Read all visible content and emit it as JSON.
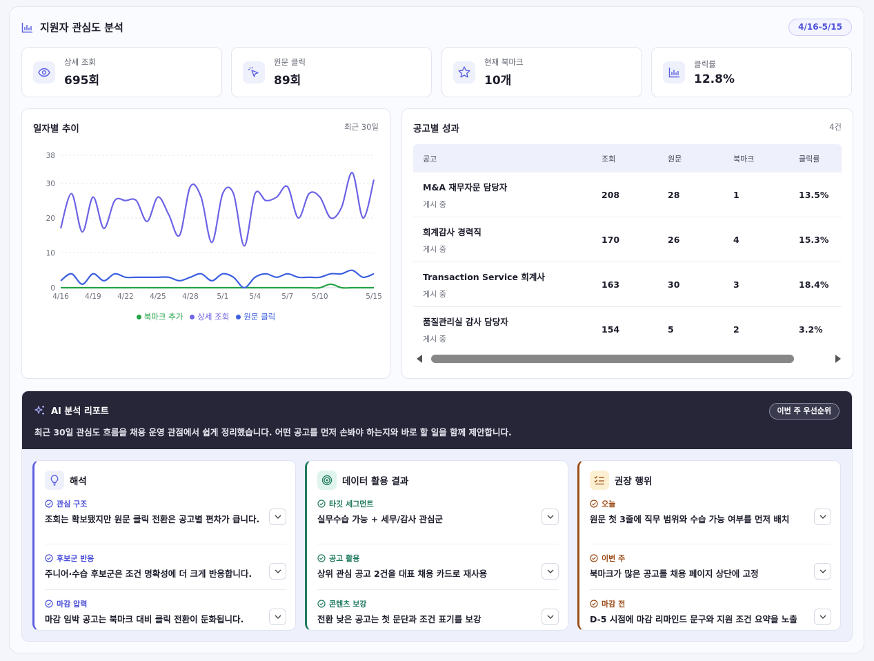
{
  "header": {
    "title": "지원자 관심도 분석",
    "date_range": "4/16-5/15"
  },
  "kpis": [
    {
      "label": "상세 조회",
      "value": "695회",
      "icon": "eye-icon"
    },
    {
      "label": "원문 클릭",
      "value": "89회",
      "icon": "cursor-click-icon"
    },
    {
      "label": "현재 북마크",
      "value": "10개",
      "icon": "star-icon"
    },
    {
      "label": "클릭률",
      "value": "12.8%",
      "icon": "bar-chart-icon"
    }
  ],
  "trend": {
    "title": "일자별 추이",
    "period": "최근 30일",
    "legend": [
      "북마크 추가",
      "상세 조회",
      "원문 클릭"
    ]
  },
  "chart_data": {
    "type": "line",
    "x_ticks": [
      "4/16",
      "4/19",
      "4/22",
      "4/25",
      "4/28",
      "5/1",
      "5/4",
      "5/7",
      "5/10",
      "5/15"
    ],
    "x": [
      "4/16",
      "4/17",
      "4/18",
      "4/19",
      "4/20",
      "4/21",
      "4/22",
      "4/23",
      "4/24",
      "4/25",
      "4/26",
      "4/27",
      "4/28",
      "4/29",
      "4/30",
      "5/1",
      "5/2",
      "5/3",
      "5/4",
      "5/5",
      "5/6",
      "5/7",
      "5/8",
      "5/9",
      "5/10",
      "5/11",
      "5/12",
      "5/13",
      "5/14",
      "5/15"
    ],
    "ylim": [
      0,
      38
    ],
    "y_ticks": [
      0,
      10,
      20,
      30,
      38
    ],
    "grid": true,
    "legend_position": "bottom",
    "series": [
      {
        "name": "상세 조회",
        "color": "#6c63e6",
        "values": [
          17,
          27,
          16,
          26,
          17,
          25,
          25,
          25,
          19,
          26,
          21,
          15,
          29,
          26,
          13,
          27,
          27,
          12,
          27,
          25,
          26,
          29,
          20,
          27,
          26,
          20,
          23,
          33,
          20,
          31
        ]
      },
      {
        "name": "원문 클릭",
        "color": "#3b5fe0",
        "values": [
          2,
          4,
          1,
          4,
          2,
          4,
          3,
          3,
          3,
          3,
          3,
          2,
          3,
          4,
          2,
          4,
          3,
          0,
          3,
          4,
          3,
          4,
          3,
          3,
          3,
          4,
          4,
          5,
          3,
          4
        ]
      },
      {
        "name": "북마크 추가",
        "color": "#22a244",
        "values": [
          0,
          0,
          0,
          0,
          0,
          0,
          0,
          0,
          0,
          0,
          0,
          0,
          0,
          0,
          0,
          0,
          0,
          0,
          0,
          0,
          0,
          0,
          0,
          0,
          0,
          1,
          0,
          0,
          0,
          0
        ]
      }
    ]
  },
  "postings": {
    "title": "공고별 성과",
    "count": "4건",
    "columns": [
      "공고",
      "조회",
      "원문",
      "북마크",
      "클릭률"
    ],
    "rows": [
      {
        "name": "M&A 재무자문 담당자",
        "status": "게시 중",
        "views": "208",
        "clicks": "28",
        "bookmarks": "1",
        "ctr": "13.5%"
      },
      {
        "name": "회계감사 경력직",
        "status": "게시 중",
        "views": "170",
        "clicks": "26",
        "bookmarks": "4",
        "ctr": "15.3%"
      },
      {
        "name": "Transaction Service 회계사",
        "status": "게시 중",
        "views": "163",
        "clicks": "30",
        "bookmarks": "3",
        "ctr": "18.4%"
      },
      {
        "name": "품질관리실 감사 담당자",
        "status": "게시 중",
        "views": "154",
        "clicks": "5",
        "bookmarks": "2",
        "ctr": "3.2%"
      }
    ]
  },
  "ai": {
    "title": "AI 분석 리포트",
    "badge": "이번 주 우선순위",
    "description": "최근 30일 관심도 흐름을 채용 운영 관점에서 쉽게 정리했습니다. 어떤 공고를 먼저 손봐야 하는지와 바로 할 일을 함께 제안합니다.",
    "cards": [
      {
        "title": "해석",
        "icon": "lightbulb-icon",
        "accent": "#5b5fe0",
        "icon_bg": "#eef0fb",
        "tag_color": "#4b4fd8",
        "items": [
          {
            "tag": "관심 구조",
            "text": "조회는 확보됐지만 원문 클릭 전환은 공고별 편차가 큽니다."
          },
          {
            "tag": "후보군 반응",
            "text": "주니어·수습 후보군은 조건 명확성에 더 크게 반응합니다."
          },
          {
            "tag": "마감 압력",
            "text": "마감 임박 공고는 북마크 대비 클릭 전환이 둔화됩니다."
          }
        ]
      },
      {
        "title": "데이터 활용 결과",
        "icon": "target-icon",
        "accent": "#1f7a5f",
        "icon_bg": "#dff4ec",
        "tag_color": "#1f7a5f",
        "items": [
          {
            "tag": "타깃 세그먼트",
            "text": "실무수습 가능 + 세무/감사 관심군"
          },
          {
            "tag": "공고 활용",
            "text": "상위 관심 공고 2건을 대표 채용 카드로 재사용"
          },
          {
            "tag": "콘텐츠 보강",
            "text": "전환 낮은 공고는 첫 문단과 조건 표기를 보강"
          }
        ]
      },
      {
        "title": "권장 행위",
        "icon": "checklist-icon",
        "accent": "#9a4a14",
        "icon_bg": "#fdf0d2",
        "tag_color": "#9a4a14",
        "items": [
          {
            "tag": "오늘",
            "text": "원문 첫 3줄에 직무 범위와 수습 가능 여부를 먼저 배치"
          },
          {
            "tag": "이번 주",
            "text": "북마크가 많은 공고를 채용 페이지 상단에 고정"
          },
          {
            "tag": "마감 전",
            "text": "D-5 시점에 마감 리마인드 문구와 지원 조건 요약을 노출"
          }
        ]
      }
    ]
  }
}
